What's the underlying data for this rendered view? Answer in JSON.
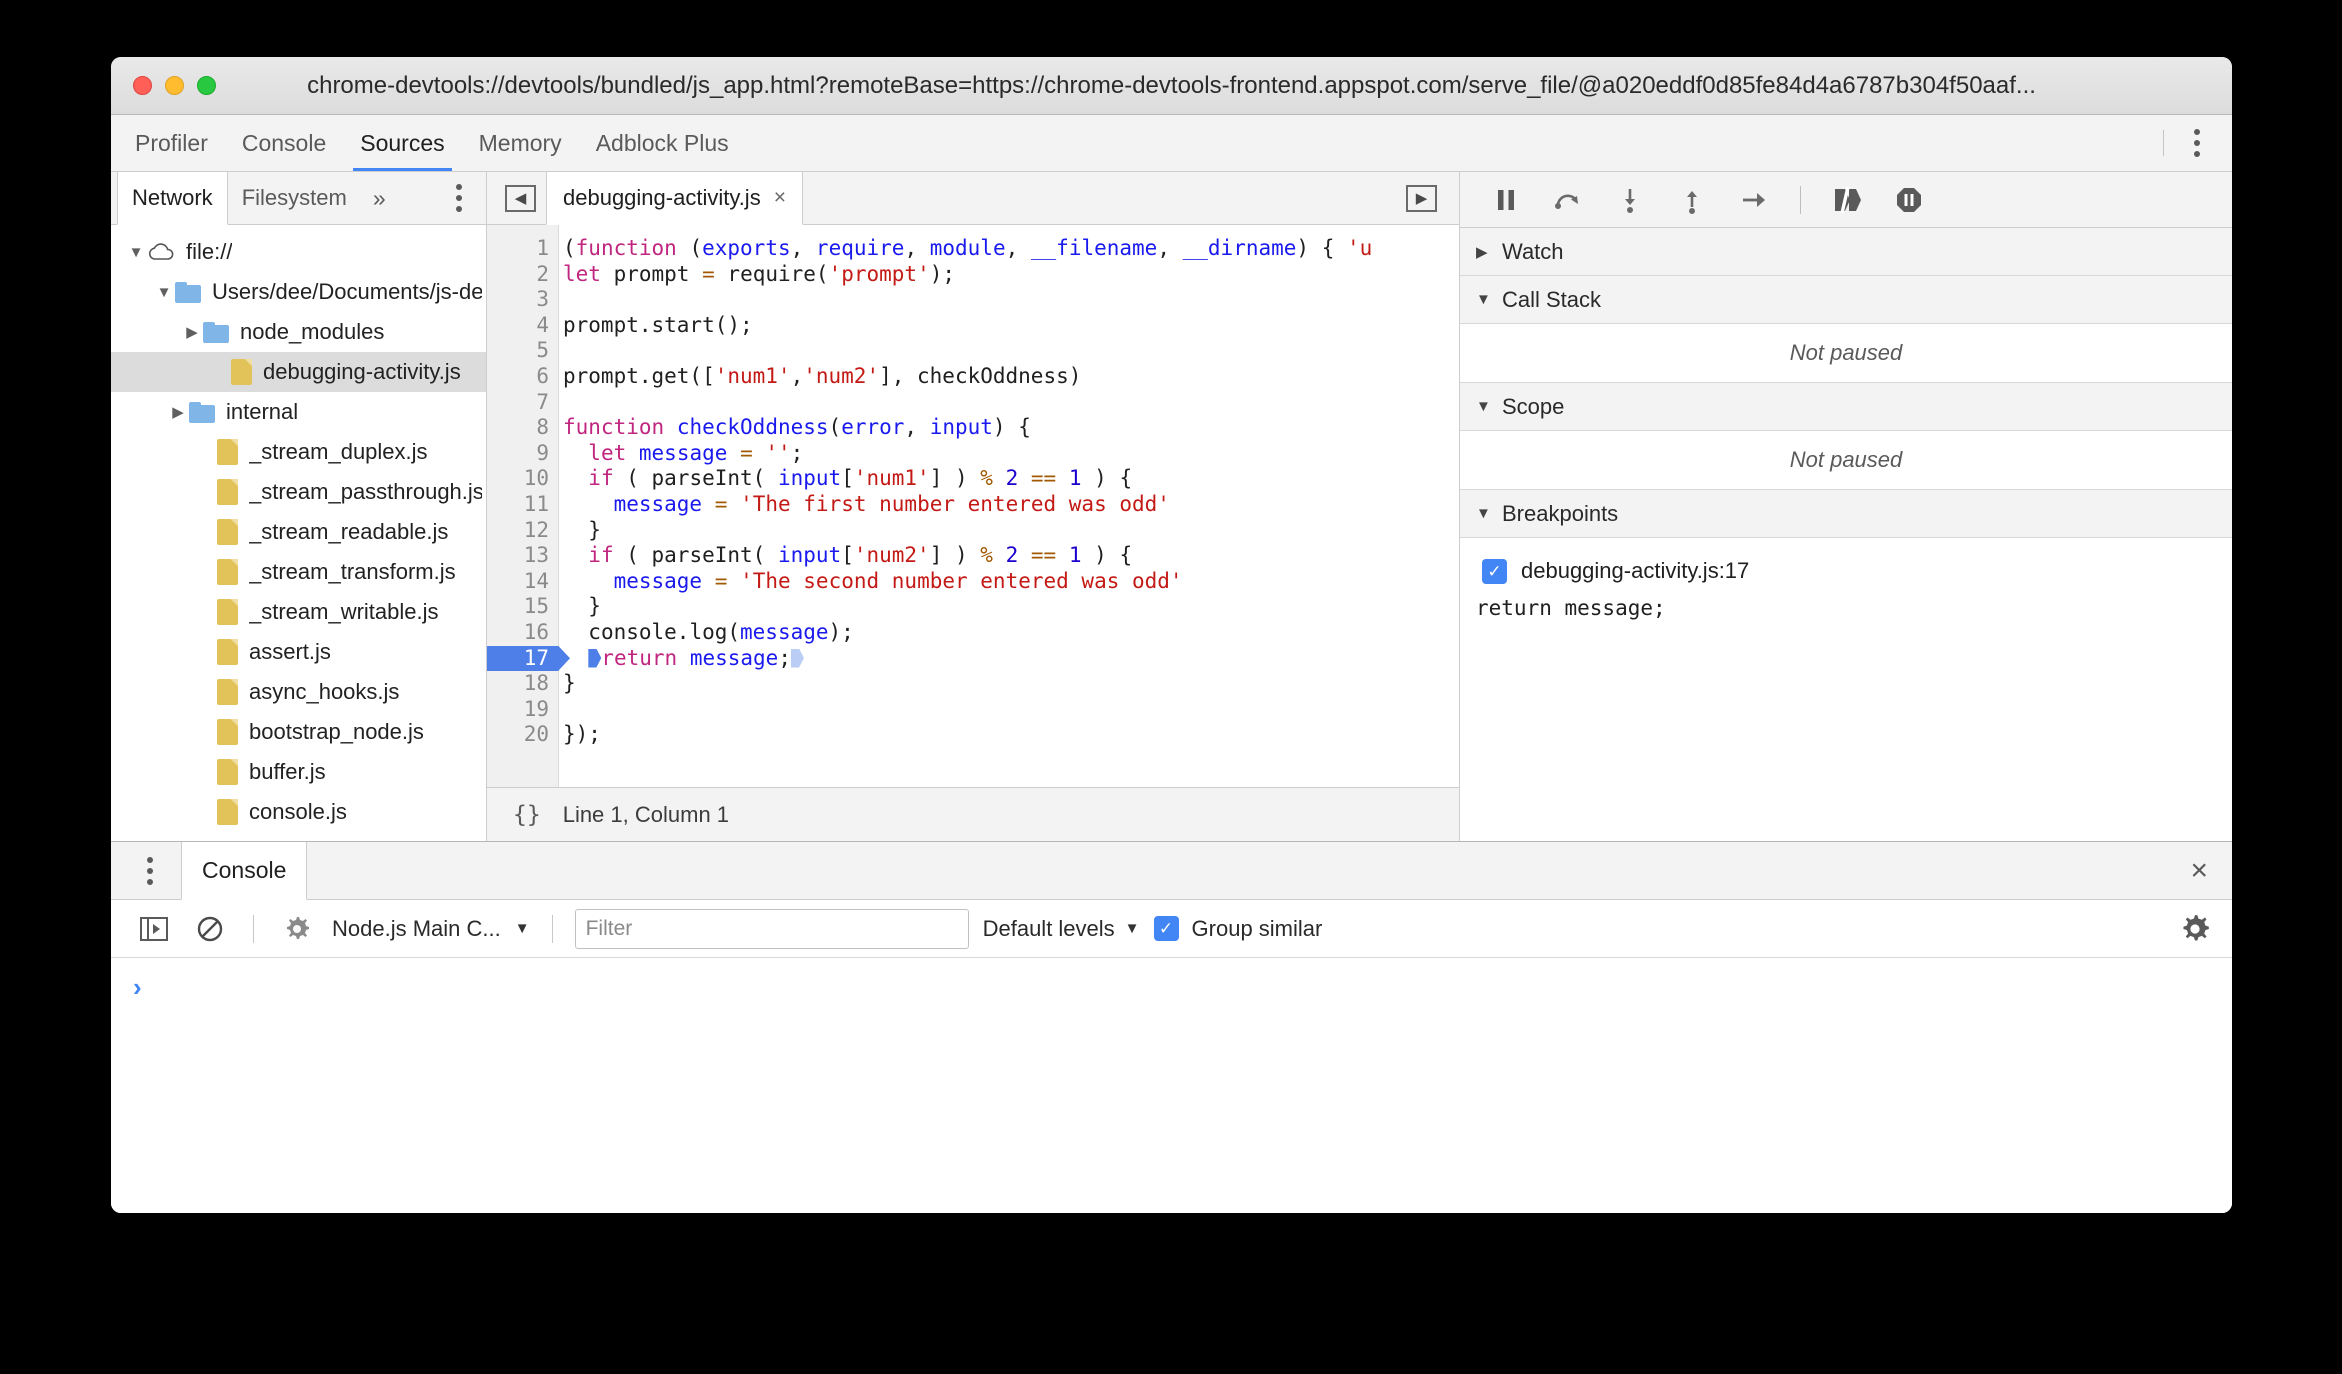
{
  "window": {
    "title": "chrome-devtools://devtools/bundled/js_app.html?remoteBase=https://chrome-devtools-frontend.appspot.com/serve_file/@a020eddf0d85fe84d4a6787b304f50aaf...",
    "traffic_lights": [
      "close",
      "minimize",
      "maximize"
    ]
  },
  "top_tabs": {
    "items": [
      {
        "label": "Profiler",
        "active": false
      },
      {
        "label": "Console",
        "active": false
      },
      {
        "label": "Sources",
        "active": true
      },
      {
        "label": "Memory",
        "active": false
      },
      {
        "label": "Adblock Plus",
        "active": false
      }
    ],
    "more_menu_icon": "kebab-menu-icon"
  },
  "navigator": {
    "tabs": [
      {
        "label": "Network",
        "active": true
      },
      {
        "label": "Filesystem",
        "active": false
      }
    ],
    "more_label": "»",
    "kebab_icon": "kebab-menu-icon",
    "tree": [
      {
        "label": "file://",
        "indent": 0,
        "twisty": "▼",
        "icon": "cloud-icon",
        "selected": false
      },
      {
        "label": "Users/dee/Documents/js-debu",
        "indent": 1,
        "twisty": "▼",
        "icon": "folder-icon",
        "selected": false
      },
      {
        "label": "node_modules",
        "indent": 2,
        "twisty": "▶",
        "icon": "folder-icon",
        "selected": false
      },
      {
        "label": "debugging-activity.js",
        "indent": 3,
        "twisty": "",
        "icon": "file-icon",
        "selected": true
      },
      {
        "label": "internal",
        "indent": 1.5,
        "twisty": "▶",
        "icon": "folder-icon",
        "selected": false
      },
      {
        "label": "_stream_duplex.js",
        "indent": 2.5,
        "twisty": "",
        "icon": "file-icon",
        "selected": false
      },
      {
        "label": "_stream_passthrough.js",
        "indent": 2.5,
        "twisty": "",
        "icon": "file-icon",
        "selected": false
      },
      {
        "label": "_stream_readable.js",
        "indent": 2.5,
        "twisty": "",
        "icon": "file-icon",
        "selected": false
      },
      {
        "label": "_stream_transform.js",
        "indent": 2.5,
        "twisty": "",
        "icon": "file-icon",
        "selected": false
      },
      {
        "label": "_stream_writable.js",
        "indent": 2.5,
        "twisty": "",
        "icon": "file-icon",
        "selected": false
      },
      {
        "label": "assert.js",
        "indent": 2.5,
        "twisty": "",
        "icon": "file-icon",
        "selected": false
      },
      {
        "label": "async_hooks.js",
        "indent": 2.5,
        "twisty": "",
        "icon": "file-icon",
        "selected": false
      },
      {
        "label": "bootstrap_node.js",
        "indent": 2.5,
        "twisty": "",
        "icon": "file-icon",
        "selected": false
      },
      {
        "label": "buffer.js",
        "indent": 2.5,
        "twisty": "",
        "icon": "file-icon",
        "selected": false
      },
      {
        "label": "console.js",
        "indent": 2.5,
        "twisty": "",
        "icon": "file-icon",
        "selected": false
      }
    ]
  },
  "editor": {
    "prev_button_icon": "panel-collapse-left-icon",
    "next_button_icon": "panel-expand-right-icon",
    "tab": {
      "label": "debugging-activity.js",
      "close": "×"
    },
    "line_numbers": [
      1,
      2,
      3,
      4,
      5,
      6,
      7,
      8,
      9,
      10,
      11,
      12,
      13,
      14,
      15,
      16,
      17,
      18,
      19,
      20
    ],
    "breakpoint_line": 17,
    "status": {
      "format_icon": "{}",
      "position": "Line 1, Column 1"
    },
    "code_lines": [
      {
        "n": 1,
        "html": "<span class=\"p\">(</span><span class=\"k\">function</span><span class=\"p\"> (</span><span class=\"v\">exports</span><span class=\"p\">, </span><span class=\"v\">require</span><span class=\"p\">, </span><span class=\"v\">module</span><span class=\"p\">, </span><span class=\"v\">__filename</span><span class=\"p\">, </span><span class=\"v\">__dirname</span><span class=\"p\">) { </span><span class=\"s\">'u</span>"
      },
      {
        "n": 2,
        "html": "<span class=\"k\">let</span> <span class=\"p\">prompt</span> <span class=\"o\">=</span> <span class=\"p\">require(</span><span class=\"s\">'prompt'</span><span class=\"p\">);</span>"
      },
      {
        "n": 3,
        "html": ""
      },
      {
        "n": 4,
        "html": "<span class=\"p\">prompt.start();</span>"
      },
      {
        "n": 5,
        "html": ""
      },
      {
        "n": 6,
        "html": "<span class=\"p\">prompt.get([</span><span class=\"s\">'num1'</span><span class=\"p\">,</span><span class=\"s\">'num2'</span><span class=\"p\">], checkOddness)</span>"
      },
      {
        "n": 7,
        "html": ""
      },
      {
        "n": 8,
        "html": "<span class=\"k\">function</span> <span class=\"v\">checkOddness</span><span class=\"p\">(</span><span class=\"v\">error</span><span class=\"p\">, </span><span class=\"v\">input</span><span class=\"p\">) {</span>"
      },
      {
        "n": 9,
        "html": "  <span class=\"k\">let</span> <span class=\"v\">message</span> <span class=\"o\">=</span> <span class=\"s\">''</span><span class=\"p\">;</span>"
      },
      {
        "n": 10,
        "html": "  <span class=\"k\">if</span><span class=\"p\"> ( parseInt( </span><span class=\"v\">input</span><span class=\"p\">[</span><span class=\"s\">'num1'</span><span class=\"p\">] ) </span><span class=\"o\">%</span> <span class=\"n\">2</span> <span class=\"o\">==</span> <span class=\"n\">1</span><span class=\"p\"> ) {</span>"
      },
      {
        "n": 11,
        "html": "    <span class=\"v\">message</span> <span class=\"o\">=</span> <span class=\"s\">'The first number entered was odd'</span>"
      },
      {
        "n": 12,
        "html": "  <span class=\"p\">}</span>"
      },
      {
        "n": 13,
        "html": "  <span class=\"k\">if</span><span class=\"p\"> ( parseInt( </span><span class=\"v\">input</span><span class=\"p\">[</span><span class=\"s\">'num2'</span><span class=\"p\">] ) </span><span class=\"o\">%</span> <span class=\"n\">2</span> <span class=\"o\">==</span> <span class=\"n\">1</span><span class=\"p\"> ) {</span>"
      },
      {
        "n": 14,
        "html": "    <span class=\"v\">message</span> <span class=\"o\">=</span> <span class=\"s\">'The second number entered was odd'</span>"
      },
      {
        "n": 15,
        "html": "  <span class=\"p\">}</span>"
      },
      {
        "n": 16,
        "html": "  <span class=\"p\">console.log(</span><span class=\"v\">message</span><span class=\"p\">);</span>"
      },
      {
        "n": 17,
        "html": "  <span class=\"arrow-dark\"></span><span class=\"k\">return</span> <span class=\"v\">message</span><span class=\"p\">;</span><span class=\"arrow-light\"></span>"
      },
      {
        "n": 18,
        "html": "<span class=\"p\">}</span>"
      },
      {
        "n": 19,
        "html": ""
      },
      {
        "n": 20,
        "html": "<span class=\"p\">});</span>"
      }
    ],
    "code_plain": [
      "(function (exports, require, module, __filename, __dirname) { 'u",
      "let prompt = require('prompt');",
      "",
      "prompt.start();",
      "",
      "prompt.get(['num1','num2'], checkOddness)",
      "",
      "function checkOddness(error, input) {",
      "  let message = '';",
      "  if ( parseInt( input['num1'] ) % 2 == 1 ) {",
      "    message = 'The first number entered was odd'",
      "  }",
      "  if ( parseInt( input['num2'] ) % 2 == 1 ) {",
      "    message = 'The second number entered was odd'",
      "  }",
      "  console.log(message);",
      "  return message;",
      "}",
      "",
      "});"
    ]
  },
  "debugger": {
    "toolbar": [
      {
        "name": "resume-pause-button",
        "icon": "pause-icon"
      },
      {
        "name": "step-over-button",
        "icon": "step-over-icon"
      },
      {
        "name": "step-into-button",
        "icon": "step-into-icon"
      },
      {
        "name": "step-out-button",
        "icon": "step-out-icon"
      },
      {
        "name": "step-button",
        "icon": "step-arrow-icon"
      },
      {
        "name": "deactivate-breakpoints-button",
        "icon": "deactivate-breakpoints-icon"
      },
      {
        "name": "pause-on-exceptions-button",
        "icon": "pause-on-exceptions-icon"
      }
    ],
    "sections": [
      {
        "title": "Watch",
        "expanded": false,
        "caret": "▶",
        "body": null
      },
      {
        "title": "Call Stack",
        "expanded": true,
        "caret": "▼",
        "body": "Not paused"
      },
      {
        "title": "Scope",
        "expanded": true,
        "caret": "▼",
        "body": "Not paused"
      },
      {
        "title": "Breakpoints",
        "expanded": true,
        "caret": "▼",
        "body": null
      }
    ],
    "breakpoints": [
      {
        "checked": true,
        "location": "debugging-activity.js:17",
        "snippet": "return message;"
      }
    ]
  },
  "console_drawer": {
    "kebab_icon": "kebab-menu-icon",
    "tab": "Console",
    "close_icon": "×",
    "toolbar": {
      "sidebar_toggle_icon": "show-console-sidebar-icon",
      "clear_icon": "clear-console-icon",
      "context_icon": "gear-context-icon",
      "context_label": "Node.js Main C...",
      "context_caret": "▼",
      "filter_placeholder": "Filter",
      "filter_value": "",
      "levels_label": "Default levels",
      "levels_caret": "▼",
      "group_similar_label": "Group similar",
      "group_similar_checked": true,
      "settings_icon": "gear-icon"
    },
    "prompt_caret": "›",
    "messages": []
  },
  "colors": {
    "accent_blue": "#4285f4",
    "breakpoint_blue": "#4e7fe8",
    "keyword_magenta": "#c0267f",
    "string_red": "#c41a16",
    "variable_blue": "#1a1aee",
    "toolbar_bg": "#f3f3f3",
    "selected_row": "#dcdcdc",
    "folder_blue": "#80b5e8",
    "file_yellow": "#e2c35a"
  }
}
